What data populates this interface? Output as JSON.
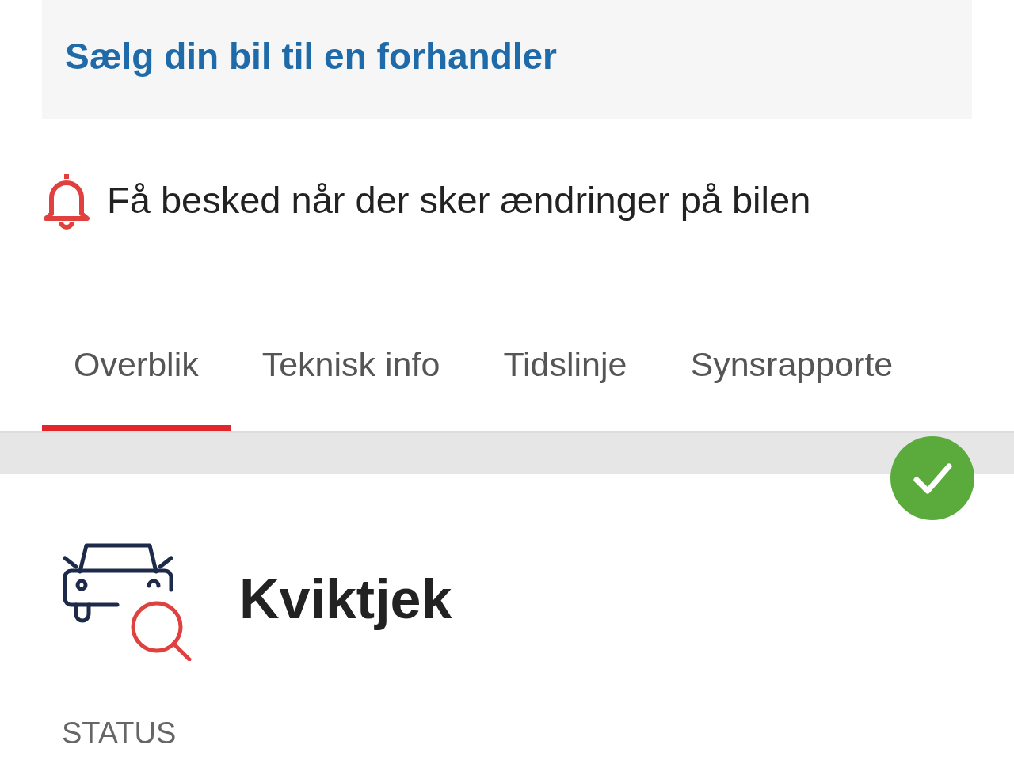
{
  "sell_link": "Sælg din bil til en forhandler",
  "notify": {
    "label": "Få besked når der sker ændringer på bilen"
  },
  "tabs": [
    {
      "label": "Overblik",
      "selected": true
    },
    {
      "label": "Teknisk info",
      "selected": false
    },
    {
      "label": "Tidslinje",
      "selected": false
    },
    {
      "label": "Synsrapporte",
      "selected": false
    }
  ],
  "check": {
    "title": "Kviktjek",
    "passed": true,
    "status_label": "STATUS"
  }
}
